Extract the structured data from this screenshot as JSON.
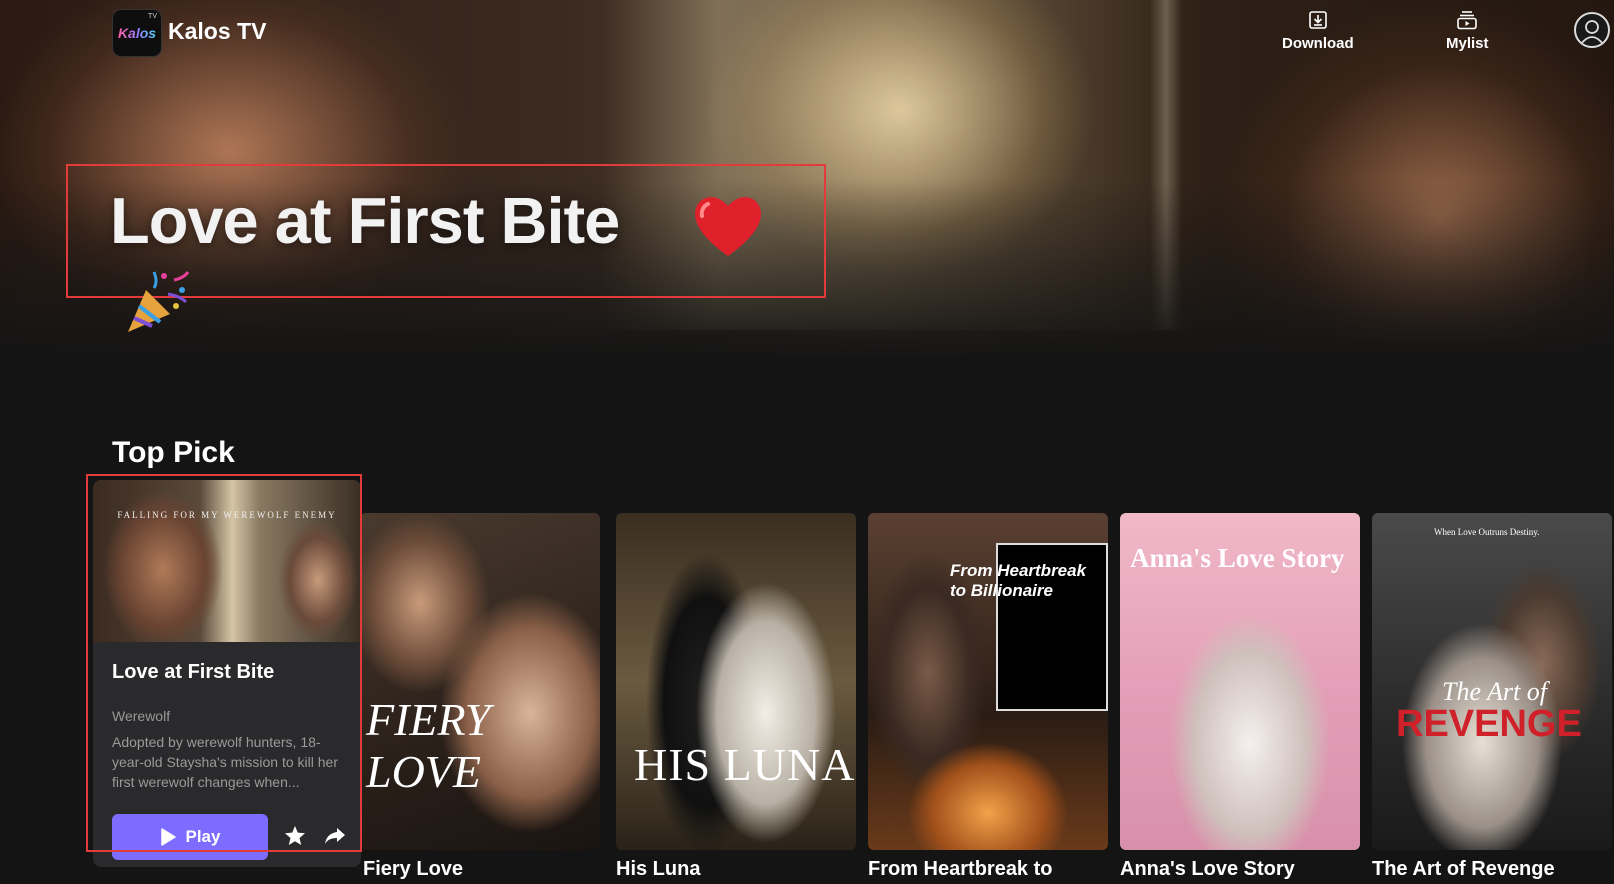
{
  "app": {
    "name": "Kalos TV",
    "logo_text": "Kalos",
    "logo_badge": "TV"
  },
  "header": {
    "nav": [
      {
        "label": "Download",
        "icon": "download-icon"
      },
      {
        "label": "Mylist",
        "icon": "mylist-icon"
      }
    ],
    "avatar_icon": "user-avatar-icon"
  },
  "hero": {
    "title": "Love at First Bite",
    "decor": [
      "heart-icon",
      "party-popper-icon"
    ]
  },
  "section": {
    "title": "Top Pick"
  },
  "featured": {
    "poster_tagline": "FALLING FOR MY WEREWOLF ENEMY",
    "title": "Love at First Bite",
    "genre": "Werewolf",
    "description": "Adopted by werewolf hunters, 18-year-old Staysha's mission to kill her first werewolf changes when...",
    "play_label": "Play",
    "actions": [
      "play-icon",
      "star-icon",
      "share-icon"
    ]
  },
  "cards": [
    {
      "title": "Fiery Love",
      "poster_text": [
        "FIERY",
        "LOVE"
      ]
    },
    {
      "title": "His Luna",
      "poster_text": [
        "HIS LUNA"
      ]
    },
    {
      "title": "From Heartbreak to",
      "poster_text": [
        "From Heartbreak",
        "to Billionaire"
      ]
    },
    {
      "title": "Anna's Love Story",
      "poster_text": [
        "Anna's Love Story"
      ]
    },
    {
      "title": "The Art of Revenge",
      "poster_text": [
        "When Love Outruns Destiny.",
        "The Art of",
        "REVENGE"
      ]
    }
  ],
  "colors": {
    "accent": "#7c6cff",
    "highlight_border": "#e23b3b",
    "background": "#141414",
    "heart": "#e0202a"
  }
}
